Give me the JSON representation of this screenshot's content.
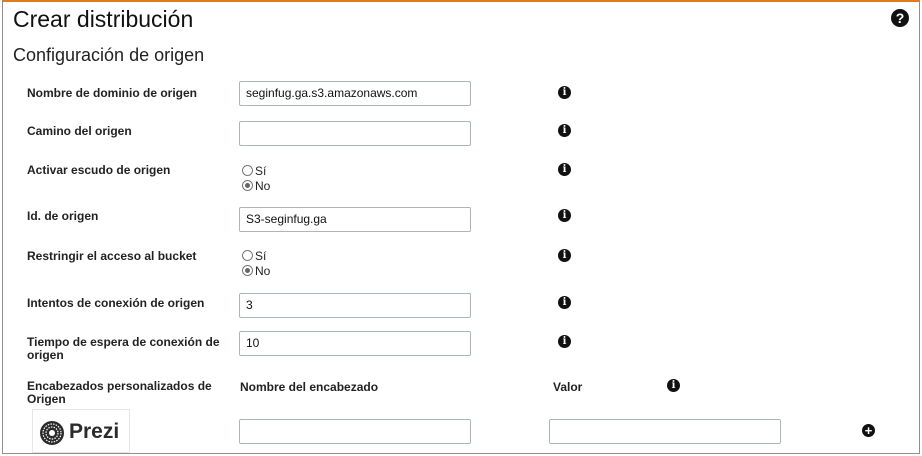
{
  "title": "Crear distribución",
  "section_title": "Configuración de origen",
  "fields": {
    "domain": {
      "label": "Nombre de dominio de origen",
      "value": "seginfug.ga.s3.amazonaws.com"
    },
    "path": {
      "label": "Camino del origen",
      "value": ""
    },
    "shield": {
      "label": "Activar escudo de origen",
      "options": [
        "Sí",
        "No"
      ],
      "selected": "No"
    },
    "origin_id": {
      "label": "Id. de origen",
      "value": "S3-seginfug.ga"
    },
    "restrict": {
      "label": "Restringir el acceso al bucket",
      "options": [
        "Sí",
        "No"
      ],
      "selected": "No"
    },
    "attempts": {
      "label": "Intentos de conexión de origen",
      "value": "3"
    },
    "timeout": {
      "label": "Tiempo de espera de conexión de origen",
      "value": "10"
    },
    "custom_headers": {
      "label": "Encabezados personalizados de Origen",
      "name_header": "Nombre del encabezado",
      "value_header": "Valor",
      "name_value": "",
      "value_value": ""
    }
  },
  "icons": {
    "help": "question-circle-icon",
    "info": "info-circle-icon",
    "add": "plus-circle-icon"
  },
  "watermark": {
    "text": "Prezi"
  },
  "colors": {
    "accent_border": "#e07b1a"
  }
}
